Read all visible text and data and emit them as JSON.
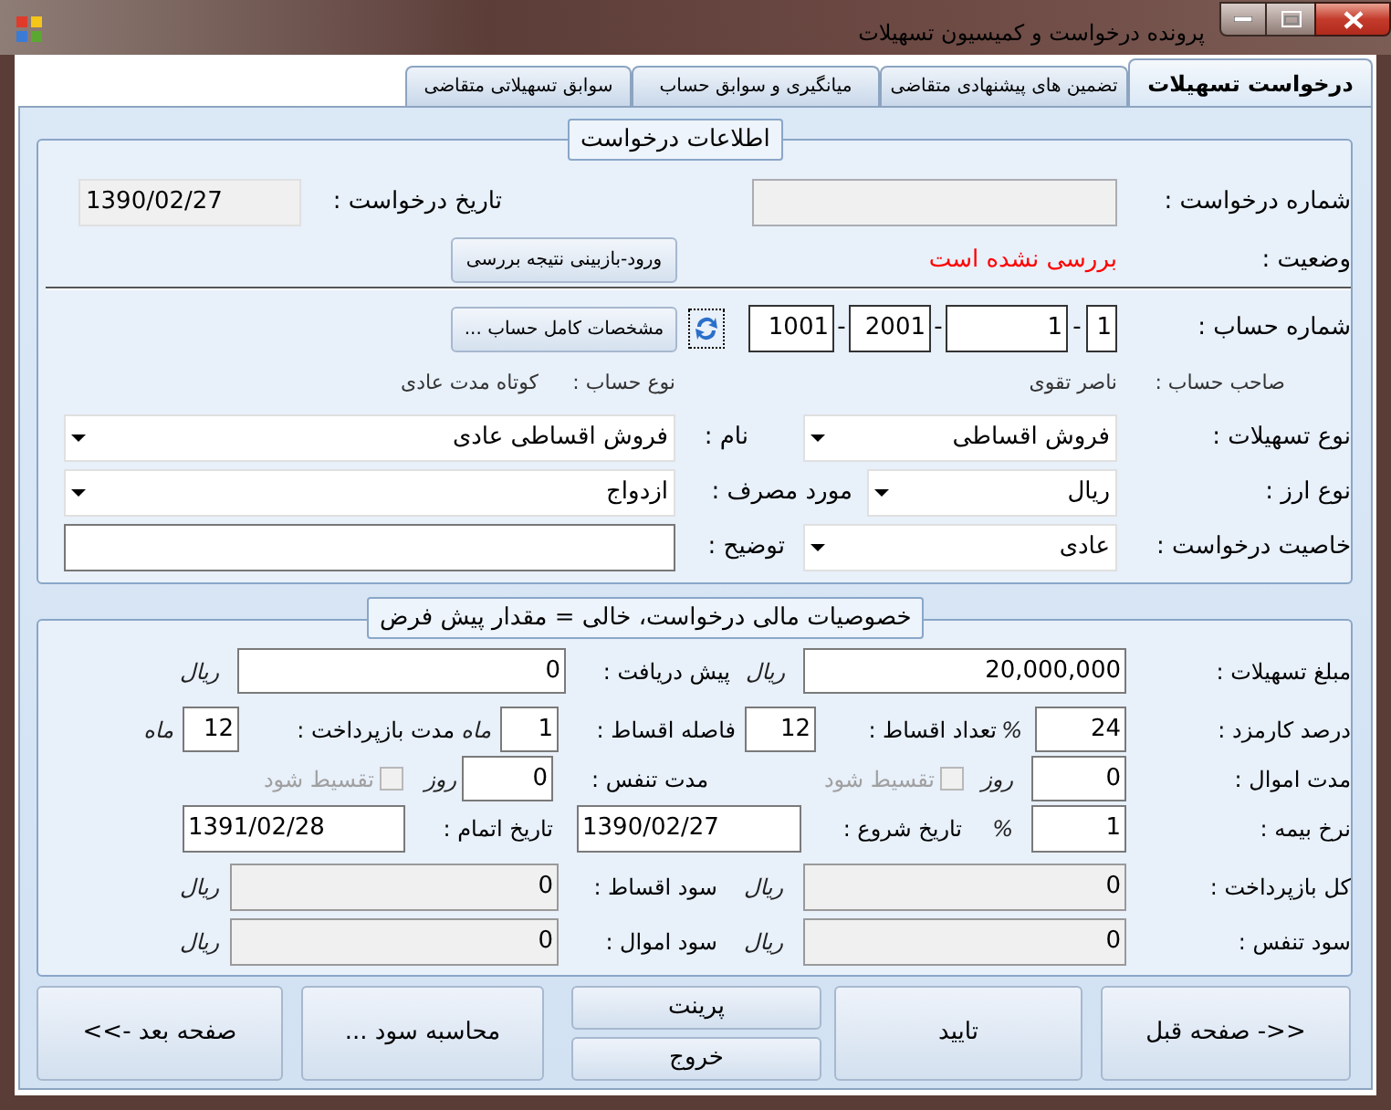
{
  "window": {
    "title": "پرونده درخواست و کمیسیون تسهیلات"
  },
  "tabs": [
    {
      "label": "درخواست تسهیلات",
      "selected": true
    },
    {
      "label": "تضمین های پیشنهادی متقاضی",
      "selected": false
    },
    {
      "label": "میانگیری و سوابق حساب",
      "selected": false
    },
    {
      "label": "سوابق تسهیلاتی متقاضی",
      "selected": false
    }
  ],
  "request_info": {
    "title": "اطلاعات درخواست",
    "request_number": {
      "label": "شماره درخواست :",
      "readonly": true
    },
    "request_date": {
      "label": "تاریخ درخواست :",
      "value": "1390/02/27",
      "readonly": true
    },
    "status": {
      "label": "وضعیت :",
      "value": "بررسی نشده است",
      "highlighted": true
    },
    "review_button": "ورود-بازبینی نتیجه بررسی",
    "account_number": {
      "label": "شماره حساب :",
      "parts": [
        {
          "kind": "field",
          "value": "1"
        },
        {
          "kind": "separator",
          "value": "-"
        },
        {
          "kind": "field",
          "value": "1"
        },
        {
          "kind": "separator",
          "value": "-"
        },
        {
          "kind": "field",
          "value": "2001"
        },
        {
          "kind": "separator",
          "value": "-"
        },
        {
          "kind": "field",
          "value": "1001"
        }
      ]
    },
    "account_details_button": "مشخصات کامل حساب ...",
    "account_holder": {
      "label": "صاحب حساب :",
      "value": "ناصر تقوی"
    },
    "account_type": {
      "label": "نوع حساب :",
      "value": "کوتاه مدت عادی"
    },
    "facility_type": {
      "label": "نوع تسهیلات :",
      "value": "فروش اقساطی"
    },
    "name": {
      "label": "نام :",
      "value": "فروش اقساطی عادی"
    },
    "currency": {
      "label": "نوع ارز :",
      "value": "ریال"
    },
    "usage": {
      "label": "مورد مصرف :",
      "value": "ازدواج"
    },
    "request_property": {
      "label": "خاصیت درخواست :",
      "value": "عادی"
    },
    "description": {
      "label": "توضیح :"
    }
  },
  "financial": {
    "title": "خصوصیات مالی درخواست، خالی = مقدار پیش فرض",
    "rows": [
      [
        {
          "label": "مبلغ تسهیلات :",
          "value": "20,000,000",
          "unit": "ریال",
          "readonly": false
        },
        {
          "label": "پیش دریافت :",
          "value": "0",
          "unit": "ریال",
          "readonly": false
        }
      ],
      [
        {
          "label": "درصد کارمزد :",
          "value": "24",
          "unit": "%",
          "readonly": false
        },
        {
          "label": "تعداد اقساط :",
          "value": "12",
          "readonly": false
        },
        {
          "label": "فاصله اقساط :",
          "value": "1",
          "unit": "ماه",
          "readonly": false
        },
        {
          "label": "مدت بازپرداخت :",
          "value": "12",
          "unit": "ماه",
          "readonly": false
        }
      ],
      [
        {
          "label": "مدت اموال :",
          "value": "0",
          "unit": "روز",
          "readonly": false,
          "checkbox": {
            "label": "تقسیط شود",
            "checked": false,
            "disabled": true
          }
        },
        {
          "label": "مدت تنفس :",
          "value": "0",
          "unit": "روز",
          "readonly": false,
          "checkbox": {
            "label": "تقسیط شود",
            "checked": false,
            "disabled": true
          }
        }
      ],
      [
        {
          "label": "نرخ بیمه :",
          "value": "1",
          "unit": "%",
          "readonly": false
        },
        {
          "label": "تاریخ شروع :",
          "value": "1390/02/27",
          "readonly": false
        },
        {
          "label": "تاریخ اتمام :",
          "value": "1391/02/28",
          "readonly": false
        }
      ],
      [
        {
          "label": "کل بازپرداخت :",
          "value": "0",
          "unit": "ریال",
          "readonly": true
        },
        {
          "label": "سود اقساط :",
          "value": "0",
          "unit": "ریال",
          "readonly": true
        }
      ],
      [
        {
          "label": "سود تنفس :",
          "value": "0",
          "unit": "ریال",
          "readonly": true
        },
        {
          "label": "سود اموال :",
          "value": "0",
          "unit": "ریال",
          "readonly": true
        }
      ]
    ]
  },
  "buttons": [
    "<<- صفحه قبل",
    "تایید",
    "پرینت",
    "خروج",
    "محاسبه سود ...",
    "صفحه بعد ->>"
  ]
}
